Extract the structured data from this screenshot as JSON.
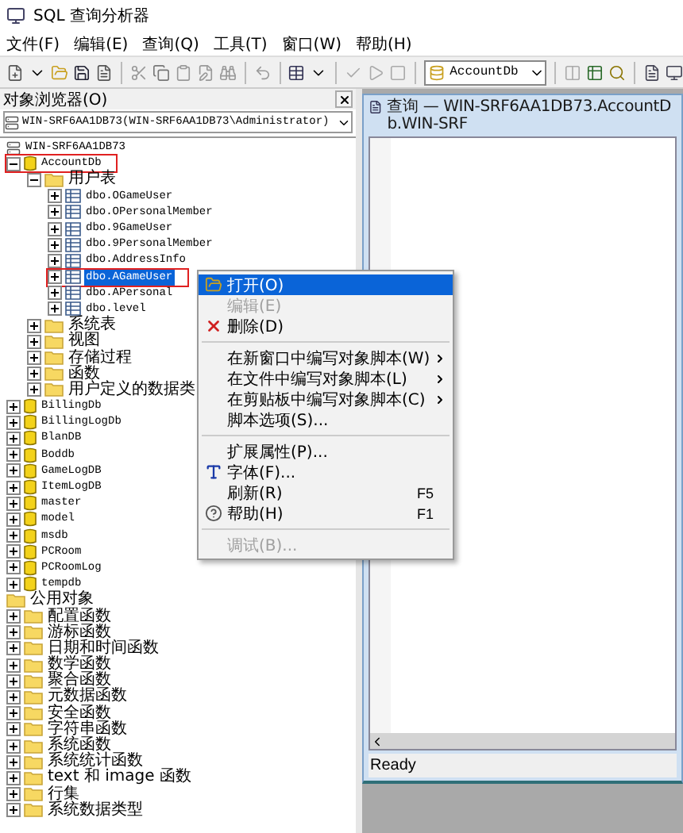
{
  "window": {
    "title": "SQL 查询分析器"
  },
  "menu": [
    "文件(F)",
    "编辑(E)",
    "查询(Q)",
    "工具(T)",
    "窗口(W)",
    "帮助(H)"
  ],
  "toolbar": {
    "database": "AccountDb"
  },
  "object_browser": {
    "title": "对象浏览器(O)",
    "server": "WIN-SRF6AA1DB73(WIN-SRF6AA1DB73\\Administrator)",
    "tree": [
      {
        "label": "WIN-SRF6AA1DB73",
        "kind": "server",
        "selected": false
      },
      {
        "label": "AccountDb",
        "kind": "database",
        "expanded": true,
        "selected": false,
        "highlighted": true,
        "children": [
          {
            "label": "用户表",
            "kind": "folder",
            "expanded": true,
            "selected": false,
            "children": [
              {
                "label": "dbo.OGameUser",
                "kind": "table",
                "expanded": false,
                "selected": false
              },
              {
                "label": "dbo.OPersonalMember",
                "kind": "table",
                "expanded": false,
                "selected": false
              },
              {
                "label": "dbo.9GameUser",
                "kind": "table",
                "expanded": false,
                "selected": false
              },
              {
                "label": "dbo.9PersonalMember",
                "kind": "table",
                "expanded": false,
                "selected": false
              },
              {
                "label": "dbo.AddressInfo",
                "kind": "table",
                "expanded": false,
                "selected": false
              },
              {
                "label": "dbo.AGameUser",
                "kind": "table",
                "expanded": false,
                "selected": true,
                "highlighted": true
              },
              {
                "label": "dbo.APersonal",
                "kind": "table",
                "expanded": false,
                "selected": false
              },
              {
                "label": "dbo.level",
                "kind": "table",
                "expanded": false,
                "selected": false
              }
            ]
          },
          {
            "label": "系统表",
            "kind": "folder",
            "expanded": false,
            "selected": false
          },
          {
            "label": "视图",
            "kind": "folder",
            "expanded": false,
            "selected": false
          },
          {
            "label": "存储过程",
            "kind": "folder",
            "expanded": false,
            "selected": false
          },
          {
            "label": "函数",
            "kind": "folder",
            "expanded": false,
            "selected": false
          },
          {
            "label": "用户定义的数据类",
            "kind": "folder",
            "expanded": false,
            "selected": false
          }
        ]
      },
      {
        "label": "BillingDb",
        "kind": "database",
        "expanded": false,
        "selected": false
      },
      {
        "label": "BillingLogDb",
        "kind": "database",
        "expanded": false,
        "selected": false
      },
      {
        "label": "BlanDB",
        "kind": "database",
        "expanded": false,
        "selected": false
      },
      {
        "label": "Boddb",
        "kind": "database",
        "expanded": false,
        "selected": false
      },
      {
        "label": "GameLogDB",
        "kind": "database",
        "expanded": false,
        "selected": false
      },
      {
        "label": "ItemLogDB",
        "kind": "database",
        "expanded": false,
        "selected": false
      },
      {
        "label": "master",
        "kind": "database",
        "expanded": false,
        "selected": false
      },
      {
        "label": "model",
        "kind": "database",
        "expanded": false,
        "selected": false
      },
      {
        "label": "msdb",
        "kind": "database",
        "expanded": false,
        "selected": false
      },
      {
        "label": "PCRoom",
        "kind": "database",
        "expanded": false,
        "selected": false
      },
      {
        "label": "PCRoomLog",
        "kind": "database",
        "expanded": false,
        "selected": false
      },
      {
        "label": "tempdb",
        "kind": "database",
        "expanded": false,
        "selected": false
      },
      {
        "label": "公用对象",
        "kind": "folder",
        "selected": false
      },
      {
        "label": "配置函数",
        "kind": "folder",
        "expanded": false,
        "selected": false
      },
      {
        "label": "游标函数",
        "kind": "folder",
        "expanded": false,
        "selected": false
      },
      {
        "label": "日期和时间函数",
        "kind": "folder",
        "expanded": false,
        "selected": false
      },
      {
        "label": "数学函数",
        "kind": "folder",
        "expanded": false,
        "selected": false
      },
      {
        "label": "聚合函数",
        "kind": "folder",
        "expanded": false,
        "selected": false
      },
      {
        "label": "元数据函数",
        "kind": "folder",
        "expanded": false,
        "selected": false
      },
      {
        "label": "安全函数",
        "kind": "folder",
        "expanded": false,
        "selected": false
      },
      {
        "label": "字符串函数",
        "kind": "folder",
        "expanded": false,
        "selected": false
      },
      {
        "label": "系统函数",
        "kind": "folder",
        "expanded": false,
        "selected": false
      },
      {
        "label": "系统统计函数",
        "kind": "folder",
        "expanded": false,
        "selected": false
      },
      {
        "label": "text 和 image 函数",
        "kind": "folder",
        "expanded": false,
        "selected": false
      },
      {
        "label": "行集",
        "kind": "folder",
        "expanded": false,
        "selected": false
      },
      {
        "label": "系统数据类型",
        "kind": "folder",
        "expanded": false,
        "selected": false
      }
    ]
  },
  "context_menu": [
    {
      "kind": "item",
      "label": "打开(O)",
      "selected": true,
      "disabled": false
    },
    {
      "kind": "item",
      "label": "编辑(E)",
      "selected": false,
      "disabled": true
    },
    {
      "kind": "item",
      "label": "删除(D)",
      "selected": false,
      "disabled": false
    },
    {
      "kind": "separator"
    },
    {
      "kind": "item",
      "label": "在新窗口中编写对象脚本(W)",
      "submenu": true,
      "selected": false,
      "disabled": false
    },
    {
      "kind": "item",
      "label": "在文件中编写对象脚本(L)",
      "submenu": true,
      "selected": false,
      "disabled": false
    },
    {
      "kind": "item",
      "label": "在剪贴板中编写对象脚本(C)",
      "submenu": true,
      "selected": false,
      "disabled": false
    },
    {
      "kind": "item",
      "label": "脚本选项(S)...",
      "selected": false,
      "disabled": false
    },
    {
      "kind": "separator"
    },
    {
      "kind": "item",
      "label": "扩展属性(P)...",
      "selected": false,
      "disabled": false
    },
    {
      "kind": "item",
      "label": "字体(F)...",
      "selected": false,
      "disabled": false
    },
    {
      "kind": "item",
      "label": "刷新(R)",
      "shortcut": "F5",
      "selected": false,
      "disabled": false
    },
    {
      "kind": "item",
      "label": "帮助(H)",
      "shortcut": "F1",
      "selected": false,
      "disabled": false
    },
    {
      "kind": "separator"
    },
    {
      "kind": "item",
      "label": "调试(B)...",
      "selected": false,
      "disabled": true
    }
  ],
  "query_window": {
    "title": "查询 — WIN-SRF6AA1DB73.AccountDb.WIN-SRF",
    "status": "Ready"
  }
}
